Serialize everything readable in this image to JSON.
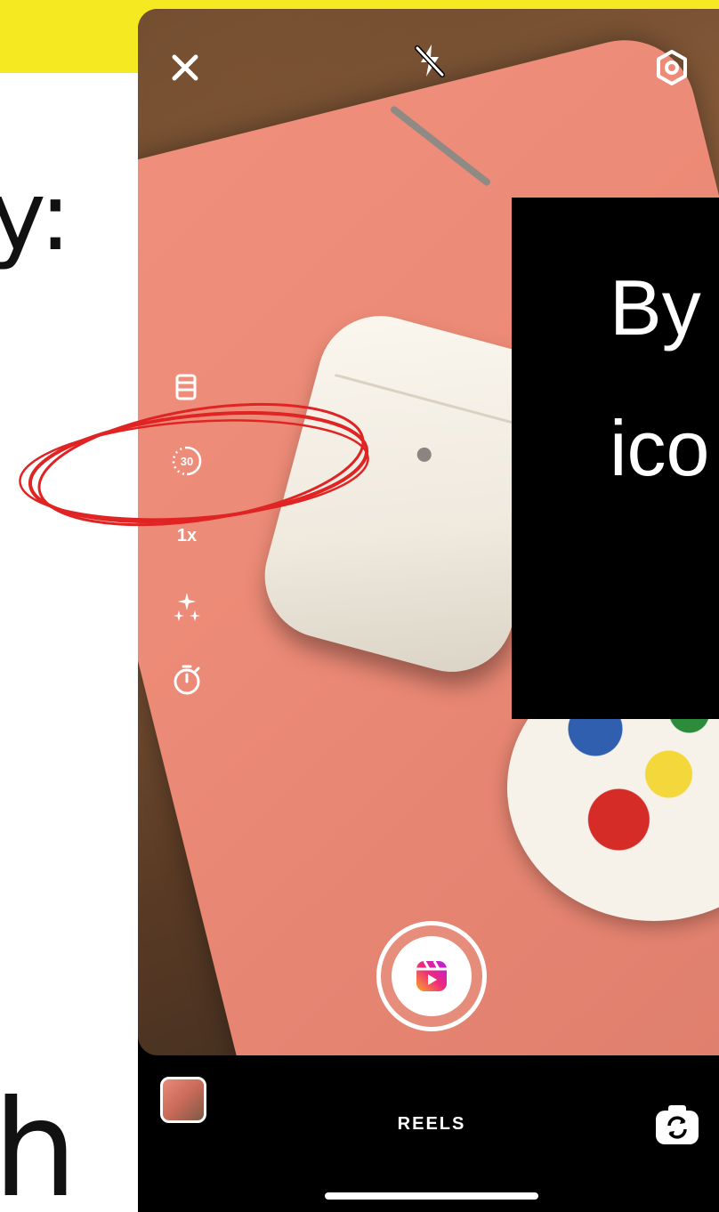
{
  "article": {
    "left_glyph_top": "y:",
    "left_glyph_bottom": "h"
  },
  "callout": {
    "line1": "By",
    "line2": "ico"
  },
  "camera": {
    "top_controls": [
      "close-icon",
      "flash-off-icon",
      "settings-icon"
    ],
    "side_tools": [
      {
        "icon": "music-icon"
      },
      {
        "icon": "length-timer-icon",
        "label": "30"
      },
      {
        "icon": "speed-icon",
        "label": "1x"
      },
      {
        "icon": "effects-sparkle-icon"
      },
      {
        "icon": "countdown-timer-icon"
      }
    ],
    "shutter_icon": "reels-icon"
  },
  "bottom_bar": {
    "mode": "REELS",
    "gallery_icon": "gallery-thumbnail",
    "flip_icon": "flip-camera-icon"
  },
  "colors": {
    "accent_yellow": "#f5ea22",
    "annotation_red": "#e02424"
  }
}
